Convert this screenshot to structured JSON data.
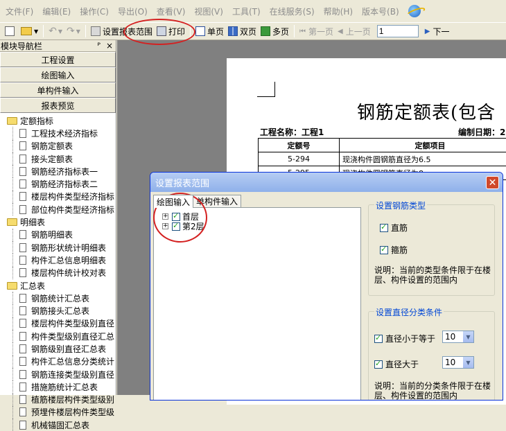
{
  "menu": {
    "items": [
      "文件(F)",
      "编辑(E)",
      "操作(C)",
      "导出(O)",
      "查看(V)",
      "视图(V)",
      "工具(T)",
      "在线服务(S)",
      "帮助(H)",
      "版本号(B)"
    ]
  },
  "toolbar": {
    "set_range": "设置报表范围",
    "print": "打印",
    "single_page": "单页",
    "double_page": "双页",
    "multi_page": "多页",
    "first_page": "第一页",
    "prev_page": "上一页",
    "page_number": "1",
    "next_page": "下一"
  },
  "nav": {
    "title": "模块导航栏",
    "pin": "ᴾ",
    "close": "×",
    "sections": [
      "工程设置",
      "绘图输入",
      "单构件输入",
      "报表预览"
    ],
    "tree": [
      {
        "label": "定额指标",
        "children": [
          "工程技术经济指标",
          "钢筋定额表",
          "接头定额表",
          "钢筋经济指标表一",
          "钢筋经济指标表二",
          "楼层构件类型经济指标",
          "部位构件类型经济指标"
        ]
      },
      {
        "label": "明细表",
        "children": [
          "钢筋明细表",
          "钢筋形状统计明细表",
          "构件汇总信息明细表",
          "楼层构件统计校对表"
        ]
      },
      {
        "label": "汇总表",
        "children": [
          "钢筋统计汇总表",
          "钢筋接头汇总表",
          "楼层构件类型级别直径",
          "构件类型级别直径汇总",
          "钢筋级别直径汇总表",
          "构件汇总信息分类统计",
          "钢筋连接类型级别直径",
          "措施筋统计汇总表",
          "植筋楼层构件类型级别",
          "预埋件楼层构件类型级",
          "机械锚固汇总表"
        ]
      }
    ]
  },
  "report": {
    "title": "钢筋定额表(包含",
    "project_label": "工程名称：工程1",
    "date_label": "编制日期：2",
    "columns": [
      "定额号",
      "定额项目"
    ],
    "rows": [
      [
        "5-294",
        "现浇构件圆钢筋直径为6.5"
      ],
      [
        "5-295",
        "现浇构件圆钢筋直径为8"
      ]
    ]
  },
  "dialog": {
    "title": "设置报表范围",
    "close": "✕",
    "tabs": [
      "绘图输入",
      "单构件输入"
    ],
    "floors": [
      {
        "expander": "+",
        "label": "首层",
        "checked": true
      },
      {
        "expander": "+",
        "label": "第2层",
        "checked": true
      }
    ],
    "rebar_type": {
      "title": "设置钢筋类型",
      "options": [
        {
          "label": "直筋",
          "checked": true
        },
        {
          "label": "箍筋",
          "checked": true
        }
      ],
      "note": "说明：当前的类型条件限于在楼层、构件设置的范围内"
    },
    "diameter": {
      "title": "设置直径分类条件",
      "options": [
        {
          "label": "直径小于等于",
          "checked": true,
          "value": "10"
        },
        {
          "label": "直径大于",
          "checked": true,
          "value": "10"
        }
      ],
      "note": "说明：当前的分类条件限于在楼层、构件设置的范围内"
    }
  },
  "colors": {
    "annotation": "#d42020",
    "dialog_title": "#8fb1ea",
    "group_title": "#0046d5"
  }
}
